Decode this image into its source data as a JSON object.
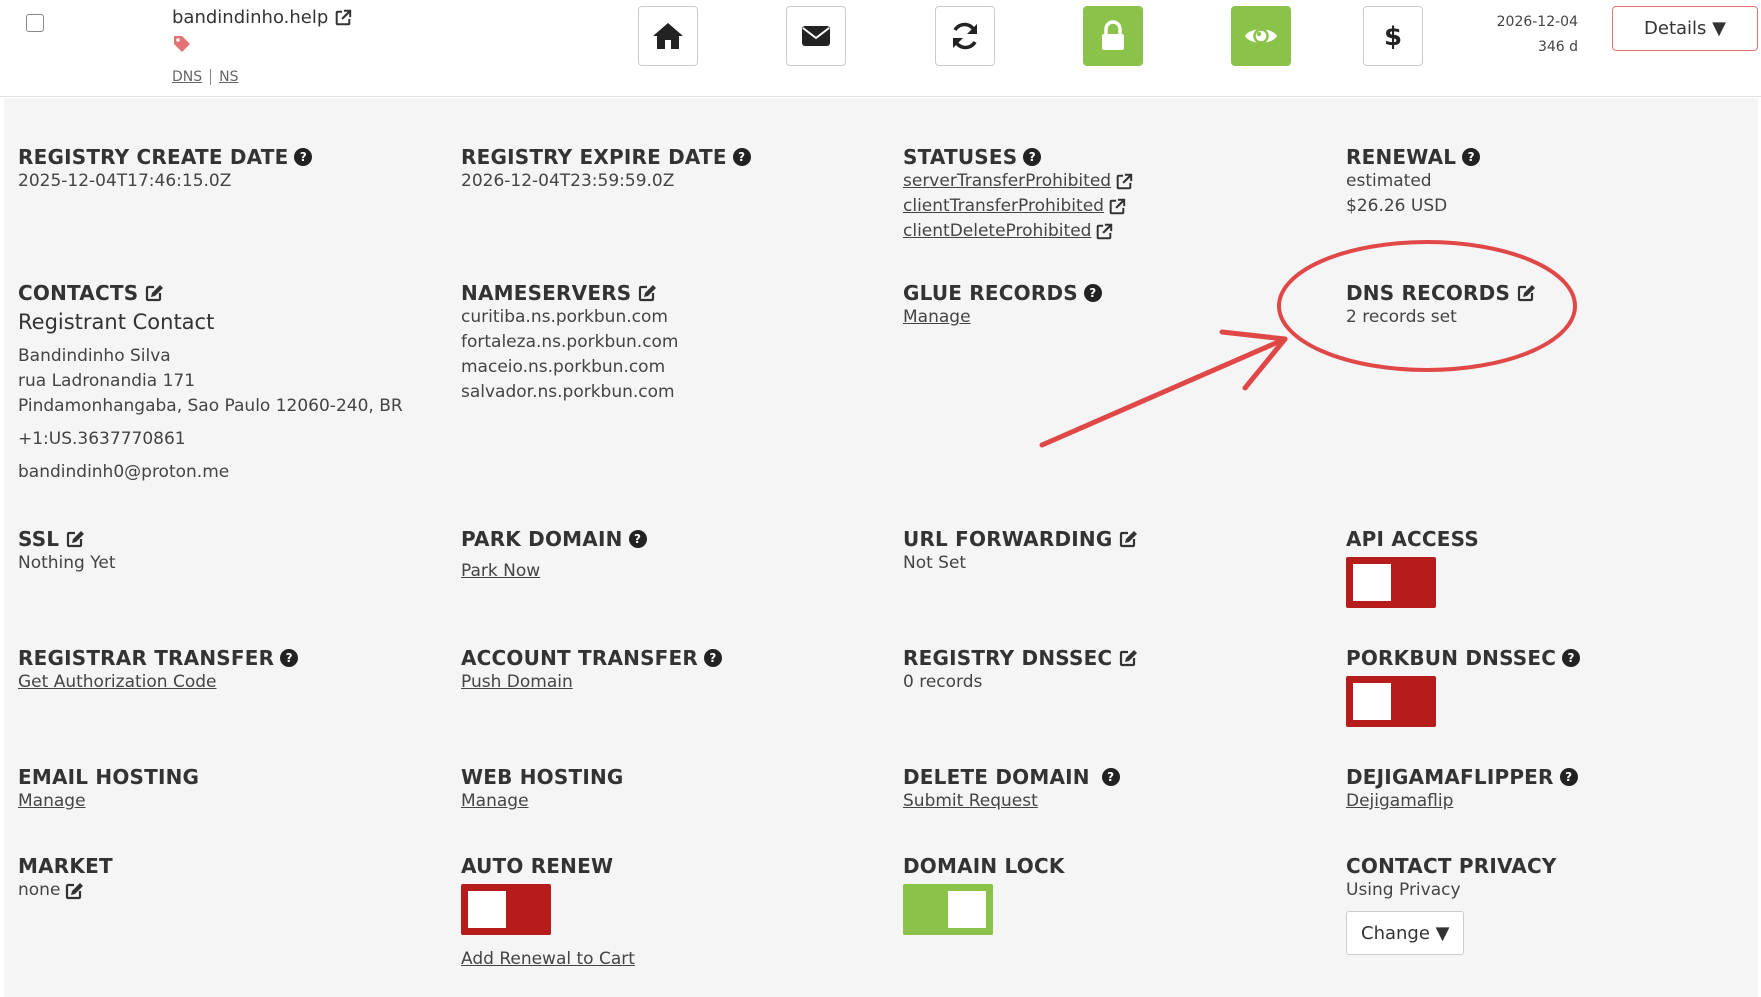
{
  "row": {
    "domain": "bandindinho.help",
    "dns_link": "DNS",
    "ns_link": "NS",
    "tools": [
      "home-icon",
      "mail-icon",
      "refresh-icon",
      "lock-icon",
      "eye-icon",
      "dollar-icon"
    ],
    "expiry_date": "2026-12-04",
    "days_left": "346 d",
    "details_label": "Details ▼"
  },
  "colors": {
    "accent_green": "#8bc34a",
    "toggle_red": "#b71c1c",
    "annotation_red": "#e53935"
  },
  "fields": {
    "registry_create": {
      "title": "REGISTRY CREATE DATE",
      "value": "2025-12-04T17:46:15.0Z"
    },
    "registry_expire": {
      "title": "REGISTRY EXPIRE DATE",
      "value": "2026-12-04T23:59:59.0Z"
    },
    "statuses": {
      "title": "STATUSES",
      "items": [
        "serverTransferProhibited",
        "clientTransferProhibited",
        "clientDeleteProhibited"
      ]
    },
    "renewal": {
      "title": "RENEWAL",
      "line1": "estimated",
      "line2": "$26.26 USD"
    },
    "contacts": {
      "title": "CONTACTS",
      "heading": "Registrant Contact",
      "name": "Bandindinho Silva",
      "street": "rua Ladronandia 171",
      "city": "Pindamonhangaba, Sao Paulo 12060-240, BR",
      "phone": "+1:US.3637770861",
      "email": "bandindinh0@proton.me"
    },
    "nameservers": {
      "title": "NAMESERVERS",
      "items": [
        "curitiba.ns.porkbun.com",
        "fortaleza.ns.porkbun.com",
        "maceio.ns.porkbun.com",
        "salvador.ns.porkbun.com"
      ]
    },
    "glue_records": {
      "title": "GLUE RECORDS",
      "link": "Manage"
    },
    "dns_records": {
      "title": "DNS RECORDS",
      "value": "2 records set"
    },
    "ssl": {
      "title": "SSL",
      "value": "Nothing Yet"
    },
    "park_domain": {
      "title": "PARK DOMAIN",
      "link": "Park Now"
    },
    "url_forwarding": {
      "title": "URL FORWARDING",
      "value": "Not Set"
    },
    "api_access": {
      "title": "API ACCESS",
      "state": "off"
    },
    "registrar_transfer": {
      "title": "REGISTRAR TRANSFER",
      "link": "Get Authorization Code"
    },
    "account_transfer": {
      "title": "ACCOUNT TRANSFER",
      "link": "Push Domain"
    },
    "registry_dnssec": {
      "title": "REGISTRY DNSSEC",
      "value": "0 records"
    },
    "porkbun_dnssec": {
      "title": "PORKBUN DNSSEC",
      "state": "off"
    },
    "email_hosting": {
      "title": "EMAIL HOSTING",
      "link": "Manage"
    },
    "web_hosting": {
      "title": "WEB HOSTING",
      "link": "Manage"
    },
    "delete_domain": {
      "title": "DELETE DOMAIN",
      "link": "Submit Request"
    },
    "dejigamaflipper": {
      "title": "DEJIGAMAFLIPPER",
      "link": "Dejigamaflip"
    },
    "market": {
      "title": "MARKET",
      "value": "none"
    },
    "auto_renew": {
      "title": "AUTO RENEW",
      "state": "off",
      "link": "Add Renewal to Cart"
    },
    "domain_lock": {
      "title": "DOMAIN LOCK",
      "state": "on"
    },
    "contact_privacy": {
      "title": "CONTACT PRIVACY",
      "value": "Using Privacy",
      "button": "Change ▼"
    }
  }
}
